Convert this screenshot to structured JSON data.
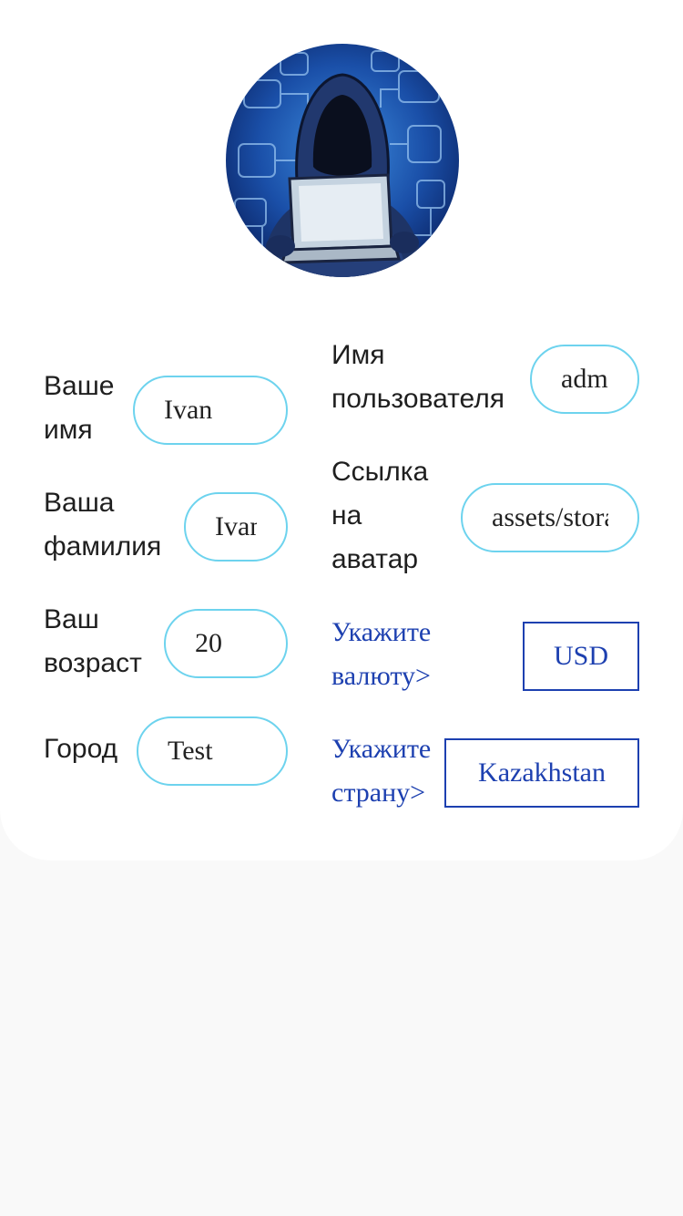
{
  "avatar": {
    "alt": "hacker avatar"
  },
  "form": {
    "first_name": {
      "label": "Ваше\nимя",
      "value": "Ivan"
    },
    "last_name": {
      "label": "Ваша\nфамилия",
      "value": "Ivan"
    },
    "age": {
      "label": "Ваш\nвозраст",
      "value": "20"
    },
    "city": {
      "label": "Город",
      "value": "Test"
    },
    "username": {
      "label": "Имя\nпользователя",
      "value": "admin"
    },
    "avatar_link": {
      "label": "Ссылка\nна\nаватар",
      "value": "assets/storage"
    },
    "currency": {
      "label": "Укажите\nвалюту>",
      "value": "USD"
    },
    "country": {
      "label": "Укажите\nстрану>",
      "value": "Kazakhstan"
    }
  },
  "colors": {
    "pill_border": "#6dd3ee",
    "link": "#1d40b0",
    "background": "#f9f9f9",
    "card": "#ffffff"
  }
}
